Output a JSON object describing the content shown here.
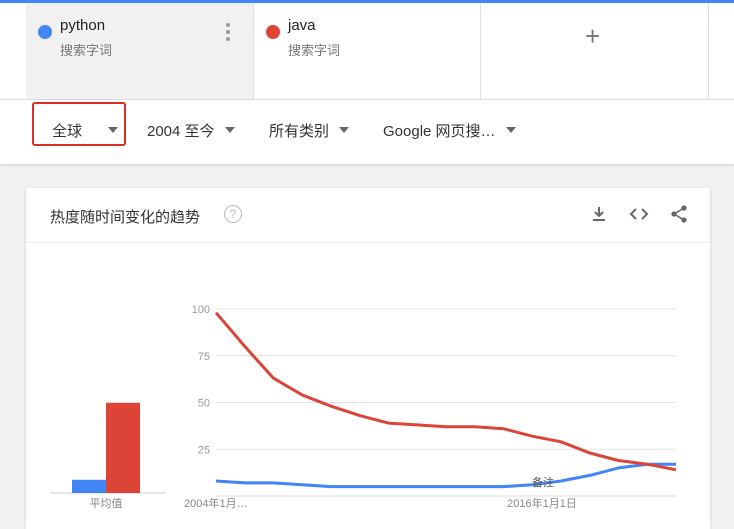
{
  "terms": [
    {
      "name": "python",
      "type": "搜索字词",
      "color": "#4285f4"
    },
    {
      "name": "java",
      "type": "搜索字词",
      "color": "#db4437"
    }
  ],
  "add_icon": "+",
  "filters": {
    "region": "全球",
    "time": "2004 至今",
    "category": "所有类别",
    "search_type": "Google 网页搜…"
  },
  "card": {
    "title": "热度随时间变化的趋势",
    "help": "?",
    "icons": [
      "download-icon",
      "embed-icon",
      "share-icon"
    ]
  },
  "chart_data": [
    {
      "type": "bar",
      "categories": [
        "python",
        "java"
      ],
      "values": [
        6,
        41
      ],
      "xlabel": "平均值",
      "colors": [
        "#4285f4",
        "#db4437"
      ]
    },
    {
      "type": "line",
      "x": [
        "2004-01",
        "2005-01",
        "2006-01",
        "2007-01",
        "2008-01",
        "2009-01",
        "2010-01",
        "2011-01",
        "2012-01",
        "2013-01",
        "2014-01",
        "2015-01",
        "2016-01",
        "2017-01",
        "2018-01",
        "2019-01",
        "2020-01"
      ],
      "series": [
        {
          "name": "python",
          "color": "#4285f4",
          "values": [
            8,
            7,
            7,
            6,
            5,
            5,
            5,
            5,
            5,
            5,
            5,
            6,
            8,
            11,
            15,
            17,
            17
          ]
        },
        {
          "name": "java",
          "color": "#db4437",
          "values": [
            98,
            80,
            63,
            54,
            48,
            43,
            39,
            38,
            37,
            37,
            36,
            32,
            29,
            23,
            19,
            17,
            14
          ]
        }
      ],
      "ylim": [
        0,
        100
      ],
      "yticks": [
        25,
        50,
        75,
        100
      ],
      "xtick_labels": [
        "2004年1月…",
        "2016年1月1日"
      ],
      "annotation": "备注",
      "grid": true
    }
  ]
}
